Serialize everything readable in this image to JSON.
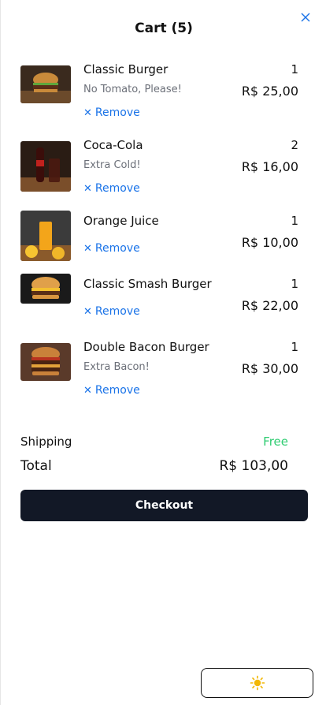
{
  "header": {
    "title": "Cart (5)"
  },
  "items": [
    {
      "name": "Classic Burger",
      "note": "No Tomato, Please!",
      "qty": "1",
      "price": "R$ 25,00",
      "remove": "Remove"
    },
    {
      "name": "Coca-Cola",
      "note": "Extra Cold!",
      "qty": "2",
      "price": "R$ 16,00",
      "remove": "Remove"
    },
    {
      "name": "Orange Juice",
      "note": "",
      "qty": "1",
      "price": "R$ 10,00",
      "remove": "Remove"
    },
    {
      "name": "Classic Smash Burger",
      "note": "",
      "qty": "1",
      "price": "R$ 22,00",
      "remove": "Remove"
    },
    {
      "name": "Double Bacon Burger",
      "note": "Extra Bacon!",
      "qty": "1",
      "price": "R$ 30,00",
      "remove": "Remove"
    }
  ],
  "summary": {
    "shipping_label": "Shipping",
    "shipping_value": "Free",
    "total_label": "Total",
    "total_value": "R$ 103,00"
  },
  "checkout_label": "Checkout",
  "colors": {
    "accent": "#1a73e8",
    "free": "#2ecc71",
    "button": "#121826",
    "sun": "#f2b705"
  }
}
